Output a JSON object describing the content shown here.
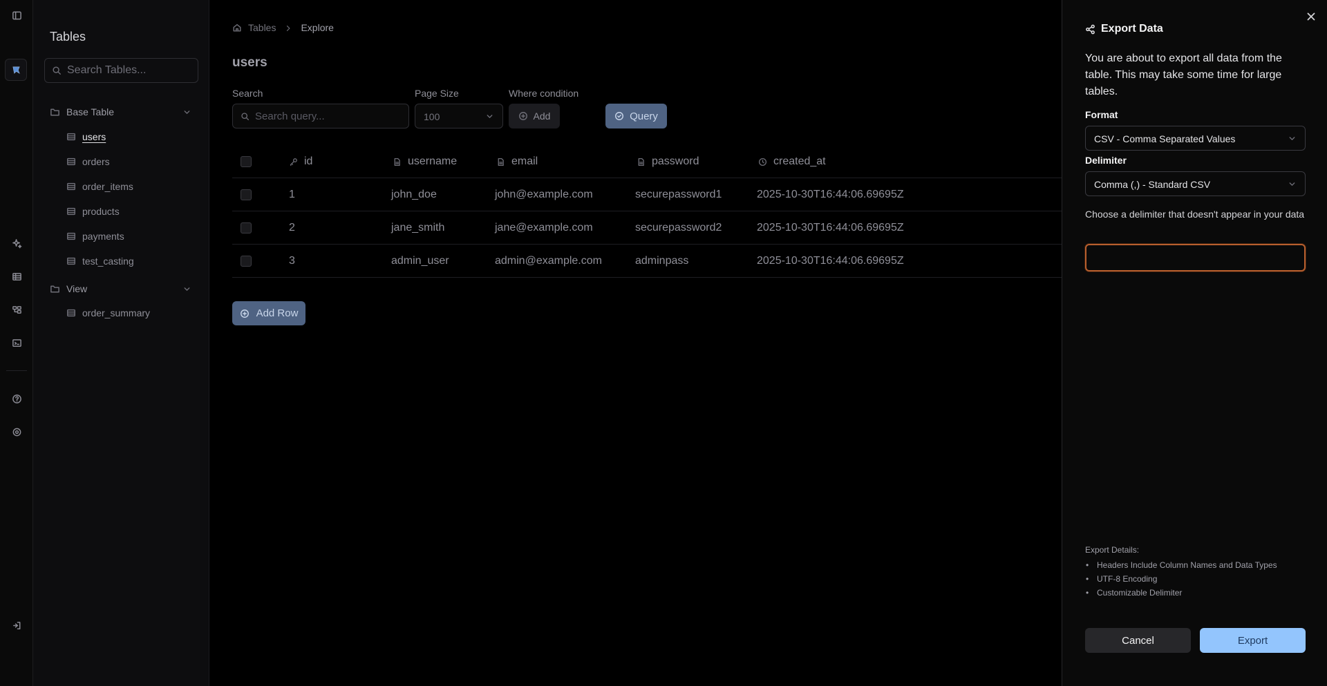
{
  "sidebar": {
    "title": "Tables",
    "search_placeholder": "Search Tables...",
    "groups": [
      {
        "label": "Base Table",
        "items": [
          "users",
          "orders",
          "order_items",
          "products",
          "payments",
          "test_casting"
        ]
      },
      {
        "label": "View",
        "items": [
          "order_summary"
        ]
      }
    ]
  },
  "breadcrumb": {
    "home": "Tables",
    "current": "Explore"
  },
  "page": {
    "title": "users"
  },
  "controls": {
    "search_label": "Search",
    "search_placeholder": "Search query...",
    "page_size_label": "Page Size",
    "page_size_value": "100",
    "where_label": "Where condition",
    "add_label": "Add",
    "query_label": "Query"
  },
  "table": {
    "columns": [
      "id",
      "username",
      "email",
      "password",
      "created_at"
    ],
    "rows": [
      [
        "1",
        "john_doe",
        "john@example.com",
        "securepassword1",
        "2025-10-30T16:44:06.69695Z"
      ],
      [
        "2",
        "jane_smith",
        "jane@example.com",
        "securepassword2",
        "2025-10-30T16:44:06.69695Z"
      ],
      [
        "3",
        "admin_user",
        "admin@example.com",
        "adminpass",
        "2025-10-30T16:44:06.69695Z"
      ]
    ],
    "add_row_label": "Add Row"
  },
  "export_panel": {
    "title": "Export Data",
    "description": "You are about to export all data from the table. This may take some time for large tables.",
    "format_label": "Format",
    "format_value": "CSV - Comma Separated Values",
    "delimiter_label": "Delimiter",
    "delimiter_value": "Comma (,) - Standard CSV",
    "delimiter_help": "Choose a delimiter that doesn't appear in your data",
    "custom_delimiter_value": "",
    "details_title": "Export Details:",
    "details": [
      "Headers Include Column Names and Data Types",
      "UTF-8 Encoding",
      "Customizable Delimiter"
    ],
    "cancel_label": "Cancel",
    "export_label": "Export"
  },
  "colors": {
    "accent": "#93c5fd",
    "primary_button": "#4f6383",
    "focus_ring": "#b85f2e"
  }
}
